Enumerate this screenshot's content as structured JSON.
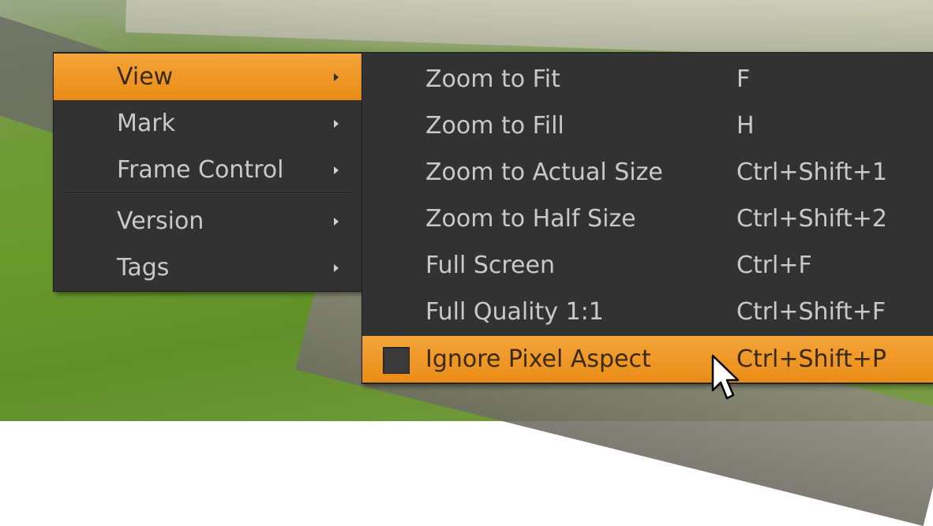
{
  "main_menu": {
    "items": [
      {
        "label": "View",
        "active": true
      },
      {
        "label": "Mark"
      },
      {
        "label": "Frame Control"
      },
      {
        "label": "Version"
      },
      {
        "label": "Tags"
      }
    ]
  },
  "view_submenu": {
    "items": [
      {
        "label": "Zoom to Fit",
        "shortcut": "F"
      },
      {
        "label": "Zoom to Fill",
        "shortcut": "H"
      },
      {
        "label": "Zoom to Actual Size",
        "shortcut": "Ctrl+Shift+1"
      },
      {
        "label": "Zoom to Half Size",
        "shortcut": "Ctrl+Shift+2"
      },
      {
        "label": "Full Screen",
        "shortcut": "Ctrl+F"
      },
      {
        "label": "Full Quality 1:1",
        "shortcut": "Ctrl+Shift+F"
      },
      {
        "label": "Ignore Pixel Aspect",
        "shortcut": "Ctrl+Shift+P",
        "checkbox": true,
        "checked": false,
        "active": true
      }
    ]
  },
  "colors": {
    "menu_bg": "#323232",
    "highlight": "#f09a25",
    "text": "#c9c9c9"
  },
  "icons": {
    "submenu_arrow": "triangle-right",
    "cursor": "mouse-pointer"
  }
}
